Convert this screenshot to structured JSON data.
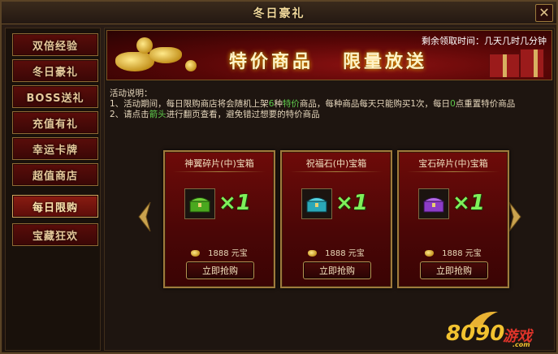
{
  "window": {
    "title": "冬日豪礼",
    "close_glyph": "✕"
  },
  "sidebar": {
    "items": [
      {
        "label": "双倍经验"
      },
      {
        "label": "冬日豪礼"
      },
      {
        "label": "BOSS送礼"
      },
      {
        "label": "充值有礼"
      },
      {
        "label": "幸运卡牌"
      },
      {
        "label": "超值商店"
      },
      {
        "label": "每日限购"
      },
      {
        "label": "宝藏狂欢"
      }
    ],
    "active_index": 6
  },
  "banner": {
    "remaining_time_label": "剩余领取时间：几天几时几分钟",
    "slogan_left": "特价商品",
    "slogan_right": "限量放送"
  },
  "description": {
    "heading": "活动说明：",
    "line1_a": "1、活动期间，每日限购商店将会随机上架",
    "line1_b": "6",
    "line1_c": "种",
    "line1_d": "特价",
    "line1_e": "商品，每种商品每天只能购买1次，每日",
    "line1_f": "0",
    "line1_g": "点重置特价商品",
    "line2_a": "2、请点击",
    "line2_b": "箭头",
    "line2_c": "进行翻页查看，避免错过想要的特价商品"
  },
  "products": [
    {
      "name": "神翼碎片(中)宝箱",
      "quantity": "×1",
      "price": "1888 元宝",
      "button": "立即抢购",
      "chest_color": "#4aa81f"
    },
    {
      "name": "祝福石(中)宝箱",
      "quantity": "×1",
      "price": "1888 元宝",
      "button": "立即抢购",
      "chest_color": "#2aa8b8"
    },
    {
      "name": "宝石碎片(中)宝箱",
      "quantity": "×1",
      "price": "1888 元宝",
      "button": "立即抢购",
      "chest_color": "#8c3cc8"
    }
  ],
  "watermark": {
    "text_num": "8090",
    "text_cn": "游戏",
    "text_domain": ".com"
  },
  "colors": {
    "accent_gold": "#d2a65c",
    "qty_green": "#7ef05a",
    "highlight_green": "#5ec94b"
  }
}
